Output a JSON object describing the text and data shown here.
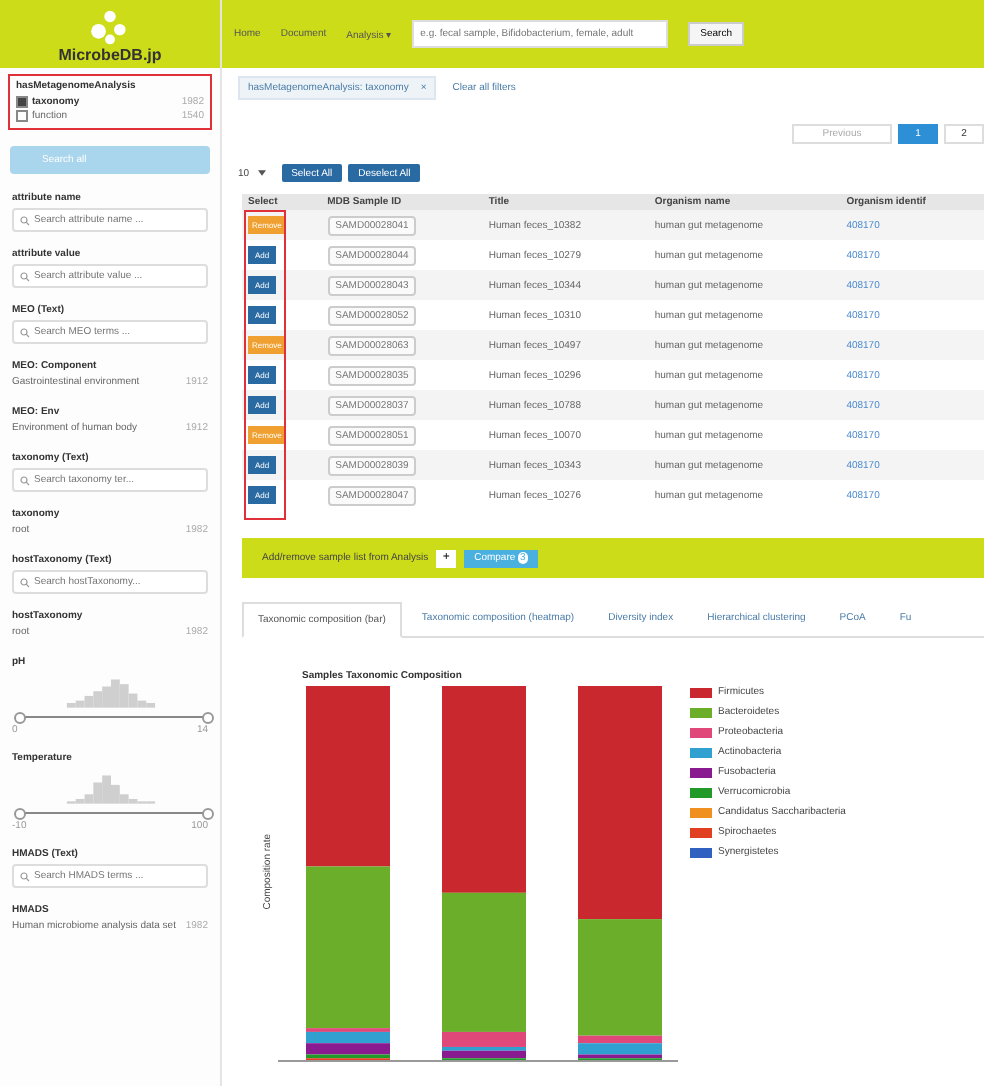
{
  "logo": {
    "text": "MicrobeDB.jp"
  },
  "nav": [
    "Home",
    "Document",
    "Analysis ▾"
  ],
  "search": {
    "placeholder": "e.g. fecal sample, Bifidobacterium, female, adult",
    "button": "Search"
  },
  "sidebar": {
    "active_facet": {
      "title": "hasMetagenomeAnalysis",
      "items": [
        {
          "label": "taxonomy",
          "count": "1982",
          "checked": true
        },
        {
          "label": "function",
          "count": "1540",
          "checked": false
        }
      ]
    },
    "search_all": "Search all",
    "facets": [
      {
        "kind": "search",
        "title": "attribute name",
        "placeholder": "Search attribute name ..."
      },
      {
        "kind": "search",
        "title": "attribute value",
        "placeholder": "Search attribute value ..."
      },
      {
        "kind": "search",
        "title": "MEO (Text)",
        "placeholder": "Search MEO terms ..."
      },
      {
        "kind": "item",
        "title": "MEO: Component",
        "label": "Gastrointestinal environment",
        "count": "1912"
      },
      {
        "kind": "item",
        "title": "MEO: Env",
        "label": "Environment of human body",
        "count": "1912"
      },
      {
        "kind": "search",
        "title": "taxonomy (Text)",
        "placeholder": "Search taxonomy ter..."
      },
      {
        "kind": "item",
        "title": "taxonomy",
        "label": "root",
        "count": "1982"
      },
      {
        "kind": "search",
        "title": "hostTaxonomy (Text)",
        "placeholder": "Search hostTaxonomy..."
      },
      {
        "kind": "item",
        "title": "hostTaxonomy",
        "label": "root",
        "count": "1982"
      },
      {
        "kind": "histogram",
        "title": "pH",
        "min": "0",
        "max": "14",
        "level": 1
      },
      {
        "kind": "histogram",
        "title": "Temperature",
        "min": "-10",
        "max": "100",
        "level": 1
      },
      {
        "kind": "search",
        "title": "HMADS (Text)",
        "placeholder": "Search HMADS terms ..."
      },
      {
        "kind": "item",
        "title": "HMADS",
        "label": "Human microbiome analysis data set",
        "count": "1982"
      }
    ]
  },
  "filters": {
    "chips": [
      "hasMetagenomeAnalysis: taxonomy"
    ],
    "chip_close": "×",
    "clear": "Clear all filters"
  },
  "pagination": {
    "previous": "Previous",
    "pages": [
      {
        "label": "1",
        "selected": true
      },
      {
        "label": "2",
        "selected": false
      }
    ]
  },
  "table_tools": {
    "page_size": "10",
    "select_all": "Select All",
    "deselect_all": "Deselect All"
  },
  "table": {
    "columns": [
      "Select",
      "MDB Sample ID",
      "Title",
      "Organism name",
      "Organism identif"
    ],
    "rows": [
      {
        "selected": true,
        "button": "Remove",
        "id": "SAMD00028041",
        "title": "Human feces_10382",
        "organism": "human gut metagenome",
        "taxid": "408170"
      },
      {
        "selected": false,
        "button": "Add",
        "id": "SAMD00028044",
        "title": "Human feces_10279",
        "organism": "human gut metagenome",
        "taxid": "408170"
      },
      {
        "selected": false,
        "button": "Add",
        "id": "SAMD00028043",
        "title": "Human feces_10344",
        "organism": "human gut metagenome",
        "taxid": "408170"
      },
      {
        "selected": false,
        "button": "Add",
        "id": "SAMD00028052",
        "title": "Human feces_10310",
        "organism": "human gut metagenome",
        "taxid": "408170"
      },
      {
        "selected": true,
        "button": "Remove",
        "id": "SAMD00028063",
        "title": "Human feces_10497",
        "organism": "human gut metagenome",
        "taxid": "408170"
      },
      {
        "selected": false,
        "button": "Add",
        "id": "SAMD00028035",
        "title": "Human feces_10296",
        "organism": "human gut metagenome",
        "taxid": "408170"
      },
      {
        "selected": false,
        "button": "Add",
        "id": "SAMD00028037",
        "title": "Human feces_10788",
        "organism": "human gut metagenome",
        "taxid": "408170"
      },
      {
        "selected": true,
        "button": "Remove",
        "id": "SAMD00028051",
        "title": "Human feces_10070",
        "organism": "human gut metagenome",
        "taxid": "408170"
      },
      {
        "selected": false,
        "button": "Add",
        "id": "SAMD00028039",
        "title": "Human feces_10343",
        "organism": "human gut metagenome",
        "taxid": "408170"
      },
      {
        "selected": false,
        "button": "Add",
        "id": "SAMD00028047",
        "title": "Human feces_10276",
        "organism": "human gut metagenome",
        "taxid": "408170"
      }
    ]
  },
  "compare_bar": {
    "text": "Add/remove sample list from Analysis",
    "add": "+",
    "button": "Compare",
    "count": "3"
  },
  "tabs": [
    {
      "label": "Taxonomic composition (bar)",
      "selected": true
    },
    {
      "label": "Taxonomic composition (heatmap)",
      "selected": false
    },
    {
      "label": "Diversity index",
      "selected": false
    },
    {
      "label": "Hierarchical clustering",
      "selected": false
    },
    {
      "label": "PCoA",
      "selected": false
    },
    {
      "label": "Fu",
      "selected": false
    }
  ],
  "chart": {
    "title": "Samples Taxonomic Composition",
    "ylabel": "Composition rate",
    "legend": [
      {
        "label": "Firmicutes",
        "color": "#c8282e"
      },
      {
        "label": "Bacteroidetes",
        "color": "#6aae2a"
      },
      {
        "label": "Proteobacteria",
        "color": "#e0487a"
      },
      {
        "label": "Actinobacteria",
        "color": "#30a0d0"
      },
      {
        "label": "Fusobacteria",
        "color": "#8a1a90"
      },
      {
        "label": "Verrucomicrobia",
        "color": "#229a2a"
      },
      {
        "label": "Candidatus Saccharibacteria",
        "color": "#f09020"
      },
      {
        "label": "Spirochaetes",
        "color": "#e04020"
      },
      {
        "label": "Synergistetes",
        "color": "#3060c0"
      }
    ]
  }
}
